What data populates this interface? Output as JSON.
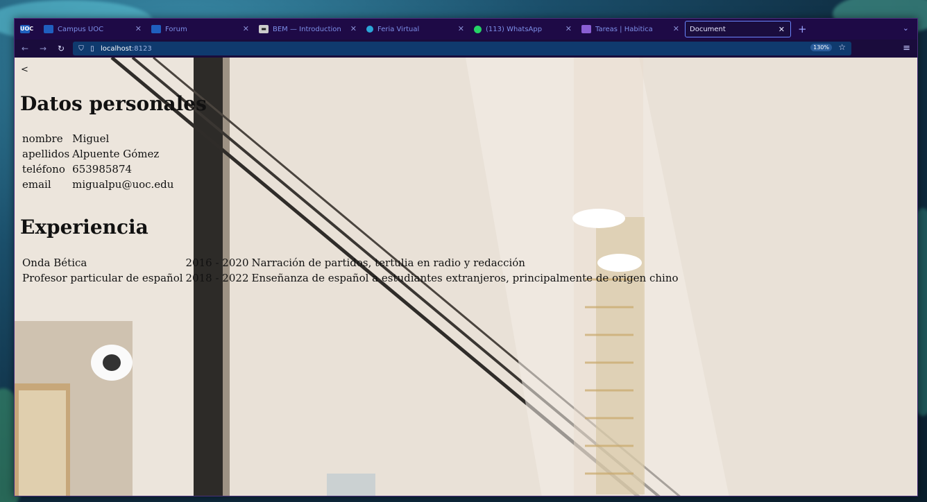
{
  "browser": {
    "tabs": [
      {
        "label": "",
        "icon": "uoc-logo-icon",
        "icon_color": "#1f5fbf"
      },
      {
        "label": "Campus UOC",
        "icon": "uoc-icon",
        "icon_color": "#1f5fbf"
      },
      {
        "label": "Forum",
        "icon": "uoc-icon",
        "icon_color": "#1f5fbf"
      },
      {
        "label": "BEM — Introduction",
        "icon": "bem-icon",
        "icon_color": "#cccccc"
      },
      {
        "label": "Feria Virtual",
        "icon": "feria-icon",
        "icon_color": "#2aa6d8"
      },
      {
        "label": "(113) WhatsApp",
        "icon": "whatsapp-icon",
        "icon_color": "#25d366"
      },
      {
        "label": "Tareas | Habitica",
        "icon": "habitica-icon",
        "icon_color": "#8a5fd3"
      },
      {
        "label": "Document",
        "icon": "",
        "icon_color": ""
      }
    ],
    "url_host": "localhost",
    "url_port": ":8123",
    "zoom": "130%"
  },
  "page": {
    "back": "<",
    "personal_heading": "Datos personales",
    "personal": [
      {
        "label": "nombre",
        "value": "Miguel"
      },
      {
        "label": "apellidos",
        "value": "Alpuente Gómez"
      },
      {
        "label": "teléfono",
        "value": "653985874"
      },
      {
        "label": "email",
        "value": "migualpu@uoc.edu"
      }
    ],
    "experience_heading": "Experiencia",
    "experience": [
      {
        "company": "Onda Bética",
        "years": "2016 - 2020",
        "description": "Narración de partidos, tertulia en radio y redacción"
      },
      {
        "company": "Profesor particular de español",
        "years": "2018 - 2022",
        "description": "Enseñanza de español a estudiantes extranjeros, principalmente de origen chino"
      }
    ]
  }
}
